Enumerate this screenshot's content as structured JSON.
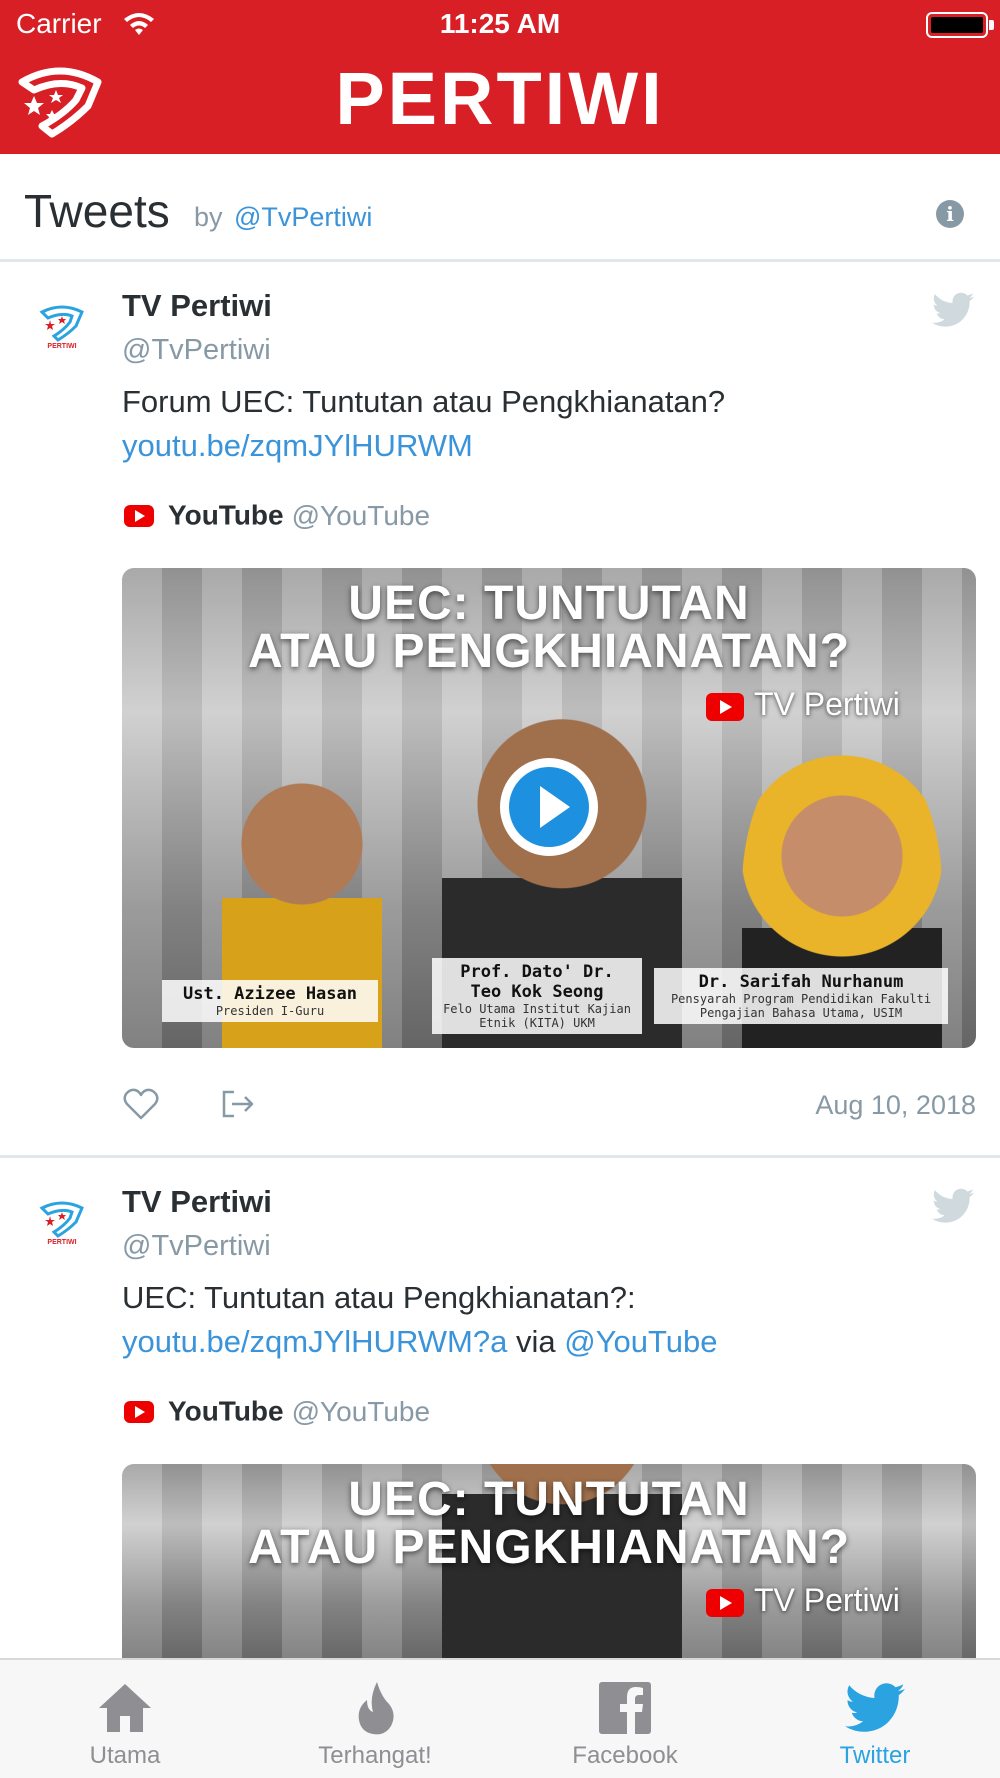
{
  "status_bar": {
    "carrier": "Carrier",
    "time": "11:25 AM"
  },
  "header": {
    "brand": "PERTIWI"
  },
  "timeline": {
    "title": "Tweets",
    "by_label": "by",
    "handle": "@TvPertiwi"
  },
  "tweets": [
    {
      "author": "TV Pertiwi",
      "handle": "@TvPertiwi",
      "text_plain": "Forum UEC: Tuntutan atau Pengkhianatan?",
      "link": "youtu.be/zqmJYlHURWM",
      "card": {
        "source_name": "YouTube",
        "source_handle": "@YouTube"
      },
      "media": {
        "headline_line1": "UEC: TUNTUTAN",
        "headline_line2": "ATAU PENGKHIANATAN?",
        "channel": "TV Pertiwi",
        "people": [
          {
            "name": "Ust. Azizee Hasan",
            "role": "Presiden I-Guru"
          },
          {
            "name": "Prof. Dato' Dr. Teo Kok Seong",
            "role": "Felo Utama Institut Kajian Etnik (KITA) UKM"
          },
          {
            "name": "Dr. Sarifah Nurhanum",
            "role": "Pensyarah Program Pendidikan Fakulti Pengajian Bahasa Utama, USIM"
          }
        ]
      },
      "date": "Aug 10, 2018"
    },
    {
      "author": "TV Pertiwi",
      "handle": "@TvPertiwi",
      "text_plain": "UEC: Tuntutan atau Pengkhianatan?:",
      "link": "youtu.be/zqmJYlHURWM?a",
      "via": "via",
      "mention": "@YouTube",
      "card": {
        "source_name": "YouTube",
        "source_handle": "@YouTube"
      },
      "media": {
        "headline_line1": "UEC: TUNTUTAN",
        "headline_line2": "ATAU PENGKHIANATAN?",
        "channel": "TV Pertiwi"
      }
    }
  ],
  "tab_bar": {
    "items": [
      {
        "label": "Utama",
        "icon": "home-icon"
      },
      {
        "label": "Terhangat!",
        "icon": "flame-icon"
      },
      {
        "label": "Facebook",
        "icon": "facebook-icon"
      },
      {
        "label": "Twitter",
        "icon": "twitter-icon",
        "active": true
      }
    ]
  },
  "colors": {
    "brand_red": "#d81f26",
    "twitter_blue": "#2aa3e0",
    "link_blue": "#3b94d9",
    "muted": "#8899a6"
  }
}
